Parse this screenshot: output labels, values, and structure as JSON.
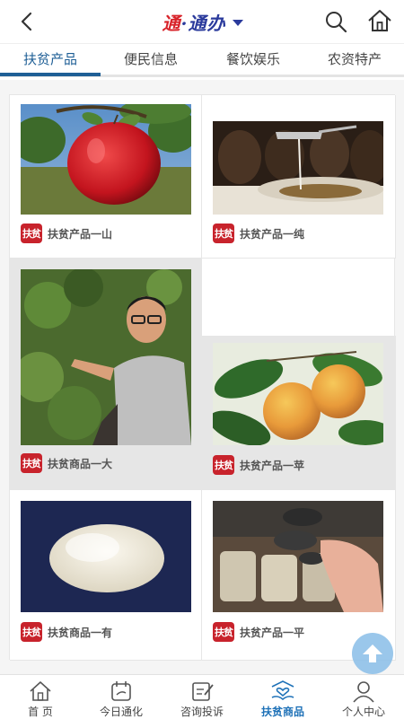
{
  "header": {
    "logo_part1": "通",
    "logo_dot": "·",
    "logo_part2": "通办",
    "back_icon": "chevron-left-icon",
    "search_icon": "search-icon",
    "home_icon": "home-icon"
  },
  "tabs": [
    {
      "label": "扶贫产品",
      "active": true
    },
    {
      "label": "便民信息",
      "active": false
    },
    {
      "label": "餐饮娱乐",
      "active": false
    },
    {
      "label": "农资特产",
      "active": false
    }
  ],
  "products": [
    {
      "title": "扶贫产品一山",
      "image": "red-apple-photo"
    },
    {
      "title": "扶贫产品一纯",
      "image": "liquor-jars-photo"
    },
    {
      "title": "扶贫商品一大",
      "image": "man-in-orchard-photo"
    },
    {
      "title": "扶贫产品一苹",
      "image": "pears-on-tree-photo"
    },
    {
      "title": "扶贫商品一有",
      "image": "rice-pile-photo"
    },
    {
      "title": "扶贫产品一平",
      "image": "mushrooms-photo"
    }
  ],
  "seal_text": "扶贫",
  "bottom_nav": [
    {
      "label": "首 页",
      "icon": "home-icon",
      "active": false
    },
    {
      "label": "今日通化",
      "icon": "calendar-icon",
      "active": false
    },
    {
      "label": "咨询投诉",
      "icon": "edit-icon",
      "active": false
    },
    {
      "label": "扶贫商品",
      "icon": "hands-heart-icon",
      "active": true
    },
    {
      "label": "个人中心",
      "icon": "person-icon",
      "active": false
    }
  ],
  "colors": {
    "accent": "#1f5f96",
    "brand_red": "#d8232a",
    "brand_blue": "#2a3a9c",
    "active_nav": "#1f72b8"
  }
}
